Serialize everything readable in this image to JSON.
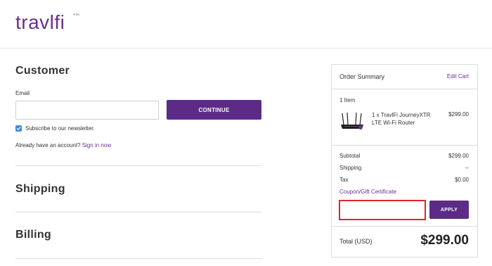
{
  "header": {
    "logo_text": "travlfi",
    "logo_tm": "®TM"
  },
  "customer": {
    "title": "Customer",
    "email_label": "Email",
    "email_value": "",
    "email_placeholder": "",
    "continue_label": "CONTINUE",
    "subscribe_checked": true,
    "subscribe_label": "Subscribe to our newsletter.",
    "account_prompt": "Already have an account?",
    "sign_in_label": "Sign in now"
  },
  "sections": {
    "shipping_title": "Shipping",
    "billing_title": "Billing"
  },
  "order_summary": {
    "title": "Order Summary",
    "edit_cart_label": "Edit Cart",
    "items_count": "1 Item",
    "item": {
      "name": "1 x TravlFi JourneyXTR LTE Wi-Fi Router",
      "price": "$299.00",
      "image_icon": "router-icon"
    },
    "subtotal_label": "Subtotal",
    "subtotal_value": "$299.00",
    "shipping_label": "Shipping",
    "shipping_value": "--",
    "tax_label": "Tax",
    "tax_value": "$0.00",
    "coupon_label": "Coupon/Gift Certificate",
    "coupon_value": "",
    "apply_label": "APPLY",
    "total_label": "Total (USD)",
    "total_value": "$299.00"
  },
  "colors": {
    "brand_purple": "#5c2b86",
    "link_purple": "#6a2f8e",
    "checkbox_blue": "#3f8fd8",
    "highlight_red": "#e0262a"
  }
}
